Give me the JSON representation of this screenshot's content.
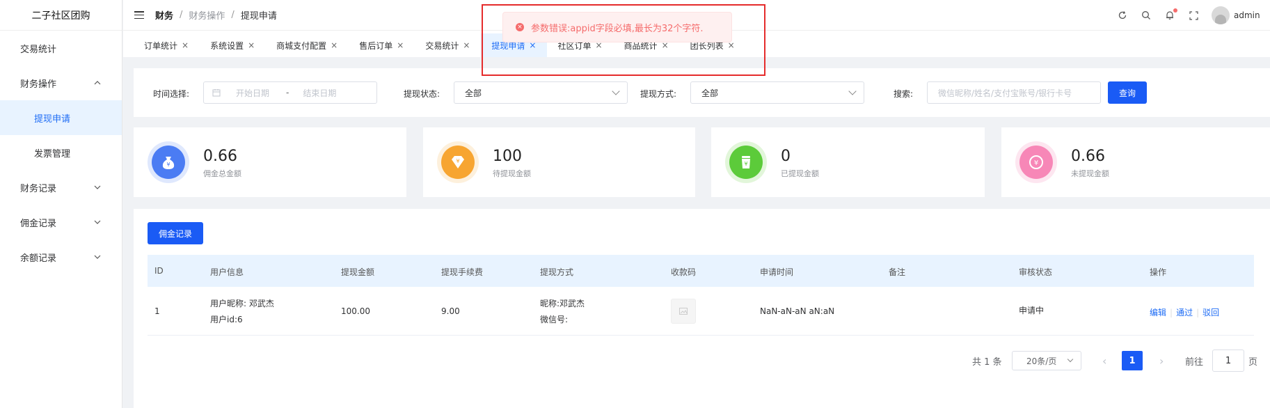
{
  "sidebar": {
    "logo": "二子社区团购",
    "items": [
      {
        "label": "交易统计",
        "chevron": ""
      },
      {
        "label": "财务操作",
        "chevron": "⌃"
      },
      {
        "label": "提现申请",
        "chevron": ""
      },
      {
        "label": "发票管理",
        "chevron": ""
      },
      {
        "label": "财务记录",
        "chevron": "⌄"
      },
      {
        "label": "佣金记录",
        "chevron": "⌄"
      },
      {
        "label": "余额记录",
        "chevron": "⌄"
      }
    ]
  },
  "header": {
    "breadcrumb": [
      "财务",
      "财务操作",
      "提现申请"
    ],
    "separator": "/",
    "user": "admin"
  },
  "tabs": [
    {
      "label": "订单统计",
      "close": "×"
    },
    {
      "label": "系统设置",
      "close": "×"
    },
    {
      "label": "商城支付配置",
      "close": "×"
    },
    {
      "label": "售后订单",
      "close": "×"
    },
    {
      "label": "交易统计",
      "close": "×"
    },
    {
      "label": "提现申请",
      "close": "×"
    },
    {
      "label": "社区订单",
      "close": "×"
    },
    {
      "label": "商品统计",
      "close": "×"
    },
    {
      "label": "团长列表",
      "close": "×"
    }
  ],
  "filters": {
    "time_label": "时间选择:",
    "start_placeholder": "开始日期",
    "range_sep": "-",
    "end_placeholder": "结束日期",
    "status_label": "提现状态:",
    "status_value": "全部",
    "method_label": "提现方式:",
    "method_value": "全部",
    "search_label": "搜索:",
    "search_placeholder": "微信昵称/姓名/支付宝账号/银行卡号",
    "query_button": "查询"
  },
  "stats": [
    {
      "value": "0.66",
      "label": "佣金总金额",
      "icon": "money-bag-icon",
      "color": "#4b7cf3",
      "ring": "#dfe8fd",
      "glyph": "¥"
    },
    {
      "value": "100",
      "label": "待提现金额",
      "icon": "diamond-icon",
      "color": "#f7a531",
      "ring": "#fdf0dc",
      "glyph": "¥"
    },
    {
      "value": "0",
      "label": "已提现金额",
      "icon": "cup-icon",
      "color": "#5ccb3a",
      "ring": "#e2f6da",
      "glyph": "¥"
    },
    {
      "value": "0.66",
      "label": "未提现金额",
      "icon": "yuan-circle-icon",
      "color": "#f787b7",
      "ring": "#fde6f0",
      "glyph": "¥"
    }
  ],
  "table": {
    "record_button": "佣金记录",
    "columns": [
      "ID",
      "用户信息",
      "提现金额",
      "提现手续费",
      "提现方式",
      "收款码",
      "申请时间",
      "备注",
      "审核状态",
      "操作"
    ],
    "rows": [
      {
        "id": "1",
        "user_nick": "用户昵称: 邓武杰",
        "user_id": "用户id:6",
        "amount": "100.00",
        "fee": "9.00",
        "method_nick": "昵称:邓武杰",
        "method_wx": "微信号:",
        "time": "NaN-aN-aN aN:aN",
        "remark": "",
        "status": "申请中",
        "actions": [
          "编辑",
          "通过",
          "驳回"
        ]
      }
    ]
  },
  "pagination": {
    "total": "共 1 条",
    "page_size": "20条/页",
    "prev": "‹",
    "current": "1",
    "next": "›",
    "goto_label": "前往",
    "goto_value": "1",
    "page_suffix": "页"
  },
  "toast": {
    "icon": "×",
    "message": "参数错误:appid字段必填,最长为32个字符."
  }
}
